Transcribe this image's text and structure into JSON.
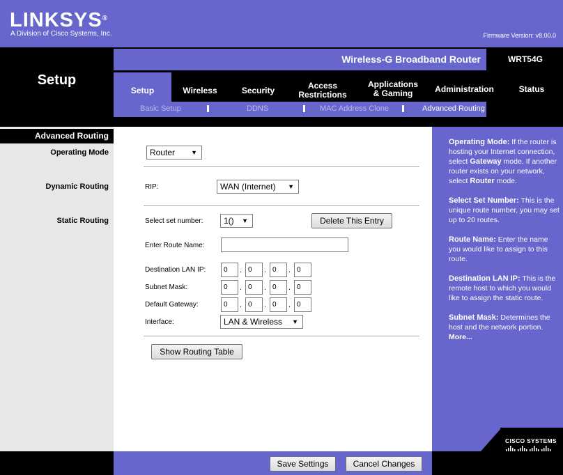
{
  "header": {
    "brand": "LINKSYS",
    "brand_mark": "®",
    "tagline": "A Division of Cisco Systems, Inc.",
    "firmware": "Firmware Version: v8.00.0",
    "product_name": "Wireless-G Broadband Router",
    "model": "WRT54G",
    "section_title": "Setup"
  },
  "tabs": [
    {
      "label": "Setup",
      "active": true
    },
    {
      "label": "Wireless"
    },
    {
      "label": "Security"
    },
    {
      "label": "Access Restrictions",
      "line1": "Access",
      "line2": "Restrictions"
    },
    {
      "label": "Applications & Gaming",
      "line1": "Applications",
      "line2": "& Gaming"
    },
    {
      "label": "Administration"
    },
    {
      "label": "Status"
    }
  ],
  "subtabs": [
    {
      "label": "Basic Setup"
    },
    {
      "label": "DDNS"
    },
    {
      "label": "MAC Address Clone"
    },
    {
      "label": "Advanced Routing",
      "active": true
    }
  ],
  "left": {
    "heading": "Advanced Routing",
    "operating_mode": "Operating Mode",
    "dynamic_routing": "Dynamic Routing",
    "static_routing": "Static Routing"
  },
  "form": {
    "operating_mode_value": "Router",
    "rip_label": "RIP:",
    "rip_value": "WAN (Internet)",
    "select_set_label": "Select set number:",
    "select_set_value": "1()",
    "delete_button": "Delete This Entry",
    "route_name_label": "Enter Route Name:",
    "route_name_value": "",
    "dest_ip_label": "Destination LAN IP:",
    "dest_ip": [
      "0",
      "0",
      "0",
      "0"
    ],
    "subnet_label": "Subnet Mask:",
    "subnet": [
      "0",
      "0",
      "0",
      "0"
    ],
    "gateway_label": "Default Gateway:",
    "gateway": [
      "0",
      "0",
      "0",
      "0"
    ],
    "interface_label": "Interface:",
    "interface_value": "LAN & Wireless",
    "dot": ".",
    "show_table_button": "Show Routing Table"
  },
  "help": {
    "op_mode_title": "Operating Mode:",
    "op_mode_text1": " If the router is hosting your Internet connection, select ",
    "op_mode_gateway": "Gateway",
    "op_mode_text2": " mode. If another router exists on your network, select ",
    "op_mode_router": "Router",
    "op_mode_text3": " mode.",
    "set_title": "Select Set Number:",
    "set_text": " This is the unique route number, you may set up to 20 routes.",
    "route_title": "Route Name:",
    "route_text": " Enter the name you would like to assign to this route.",
    "dest_title": "Destination LAN IP:",
    "dest_text": " This is the remote host to which you would like to assign the static route.",
    "subnet_title": "Subnet Mask:",
    "subnet_text": " Determines the host and the network portion.",
    "more": "More..."
  },
  "footer": {
    "save": "Save Settings",
    "cancel": "Cancel Changes",
    "cisco": "CISCO SYSTEMS"
  },
  "colors": {
    "accent": "#6666cc",
    "dark": "#000000",
    "left_panel": "#e7e7e7"
  }
}
